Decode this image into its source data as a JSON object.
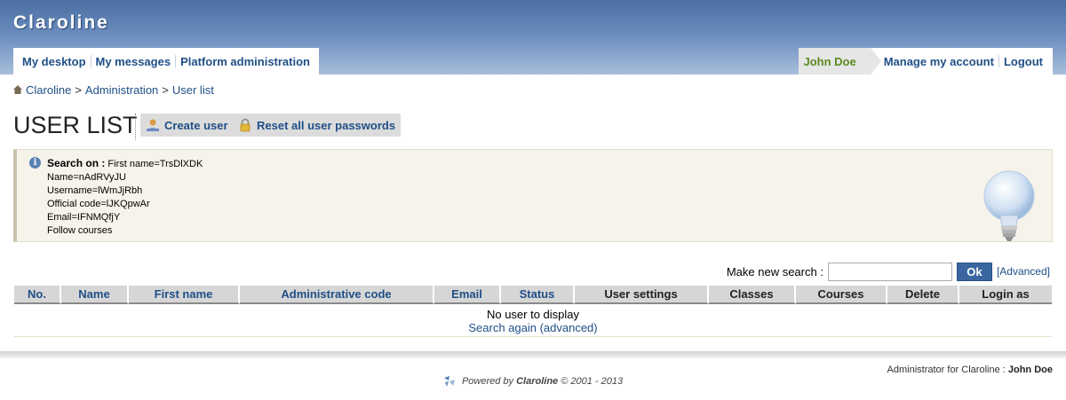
{
  "app": {
    "title": "Claroline"
  },
  "nav": {
    "left": [
      "My desktop",
      "My messages",
      "Platform administration"
    ],
    "user_name": "John Doe",
    "right": [
      "Manage my account",
      "Logout"
    ]
  },
  "breadcrumb": {
    "items": [
      "Claroline",
      "Administration"
    ],
    "separator": ">",
    "current": "User list"
  },
  "page": {
    "title": "USER LIST",
    "create_user": "Create user",
    "reset_passwords": "Reset all user passwords"
  },
  "search_info": {
    "label": "Search on :",
    "first_name": "First name=TrsDlXDK",
    "name": "Name=nAdRVyJU",
    "username": "Username=lWmJjRbh",
    "official_code": "Official code=lJKQpwAr",
    "email": "Email=IFNMQfjY",
    "follow": "Follow courses"
  },
  "search": {
    "label": "Make new search :",
    "value": "",
    "ok": "Ok",
    "advanced": "Advanced"
  },
  "table": {
    "columns": [
      {
        "label": "No.",
        "link": true
      },
      {
        "label": "Name",
        "link": true
      },
      {
        "label": "First name",
        "link": true
      },
      {
        "label": "Administrative code",
        "link": true
      },
      {
        "label": "Email",
        "link": true
      },
      {
        "label": "Status",
        "link": true
      },
      {
        "label": "User settings",
        "link": false
      },
      {
        "label": "Classes",
        "link": false
      },
      {
        "label": "Courses",
        "link": false
      },
      {
        "label": "Delete",
        "link": false
      },
      {
        "label": "Login as",
        "link": false
      }
    ],
    "empty_message": "No user to display",
    "search_again": "Search again (advanced)"
  },
  "footer": {
    "admin_label": "Administrator for Claroline :",
    "admin_name": "John Doe",
    "powered_prefix": "Powered by",
    "powered_brand": "Claroline",
    "powered_suffix": "© 2001 - 2013"
  },
  "colors": {
    "header_top": "#4b6fa3",
    "link": "#1f4f87",
    "user_name": "#5c8a1f",
    "ok_button": "#3a66a0",
    "info_bg": "#f6f3ea"
  }
}
